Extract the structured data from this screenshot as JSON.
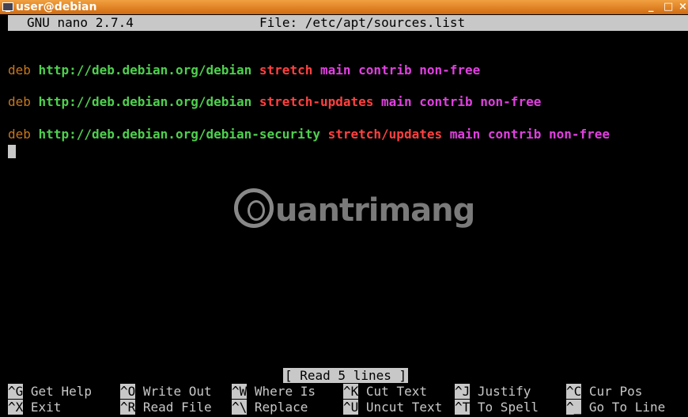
{
  "window": {
    "title": "user@debian",
    "controls": [
      "_",
      "□",
      "×"
    ]
  },
  "nano": {
    "version": "GNU nano 2.7.4",
    "file": "File: /etc/apt/sources.list",
    "status": "[ Read 5 lines ]"
  },
  "lines": [
    {
      "type": "deb",
      "url": "http://deb.debian.org/debian",
      "dist": "stretch",
      "components": "main contrib non-free"
    },
    {
      "type": "deb",
      "url": "http://deb.debian.org/debian",
      "dist": "stretch-updates",
      "components": "main contrib non-free"
    },
    {
      "type": "deb",
      "url": "http://deb.debian.org/debian-security",
      "dist": "stretch/updates",
      "components": "main contrib non-free"
    }
  ],
  "shortcuts": [
    {
      "key": "^G",
      "label": "Get Help"
    },
    {
      "key": "^O",
      "label": "Write Out"
    },
    {
      "key": "^W",
      "label": "Where Is"
    },
    {
      "key": "^K",
      "label": "Cut Text"
    },
    {
      "key": "^J",
      "label": "Justify"
    },
    {
      "key": "^C",
      "label": "Cur Pos"
    },
    {
      "key": "^X",
      "label": "Exit"
    },
    {
      "key": "^R",
      "label": "Read File"
    },
    {
      "key": "^\\",
      "label": "Replace"
    },
    {
      "key": "^U",
      "label": "Uncut Text"
    },
    {
      "key": "^T",
      "label": "To Spell"
    },
    {
      "key": "^_",
      "label": "Go To Line"
    }
  ],
  "watermark": "uantrimang",
  "colors": {
    "titlebar": "#e07f20",
    "deb": "#c8771c",
    "url": "#4ed04e",
    "dist": "#ff4040",
    "components": "#e040e0"
  }
}
